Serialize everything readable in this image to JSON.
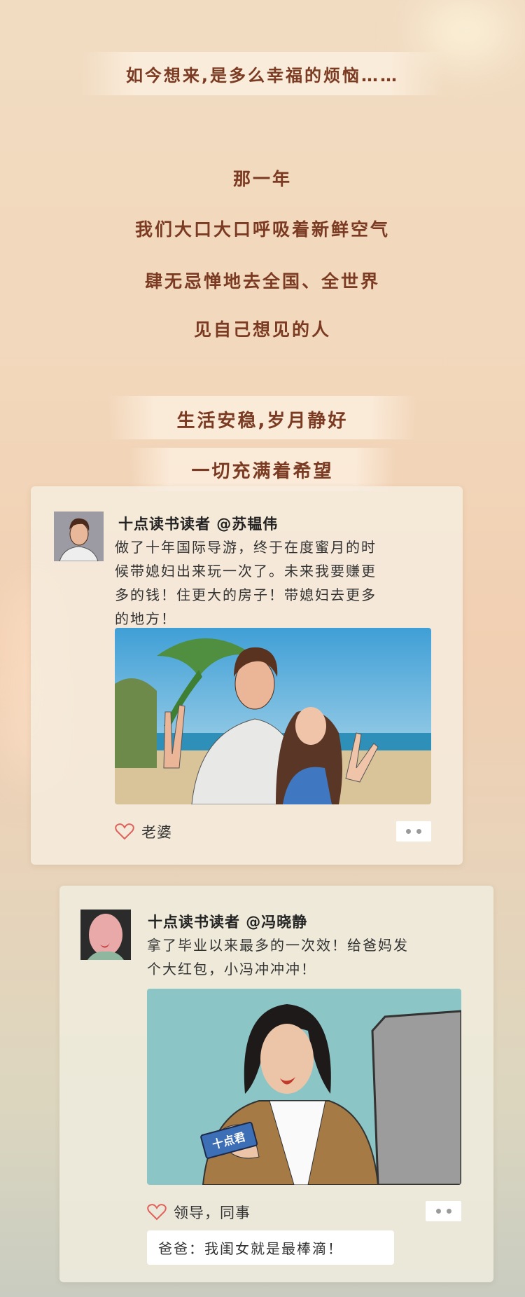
{
  "poem": {
    "line1": "如今想来,是多么幸福的烦恼……",
    "line2": "那一年",
    "line3": "我们大口大口呼吸着新鲜空气",
    "line4": "肆无忌惮地去全国、全世界",
    "line5": "见自己想见的人",
    "line6": "生活安稳,岁月静好",
    "line7": "一切充满着希望"
  },
  "posts": [
    {
      "author": "十点读书读者 @苏韫伟",
      "text_lines": [
        "做了十年国际导游，终于在度蜜月的时",
        "候带媳妇出来玩一次了。未来我要赚更",
        "多的钱！住更大的房子！带媳妇去更多",
        "的地方！"
      ],
      "likes": "老婆"
    },
    {
      "author": "十点读书读者 @冯晓静",
      "text_lines": [
        "拿了毕业以来最多的一次效！给爸妈发",
        "个大红包，小冯冲冲冲！"
      ],
      "image_badge": "十点君",
      "likes": "领导，同事",
      "comment": "爸爸：我闺女就是最棒滴！"
    }
  ],
  "colors": {
    "poem_text": "#7b3a22",
    "heart": "#e0605a"
  }
}
